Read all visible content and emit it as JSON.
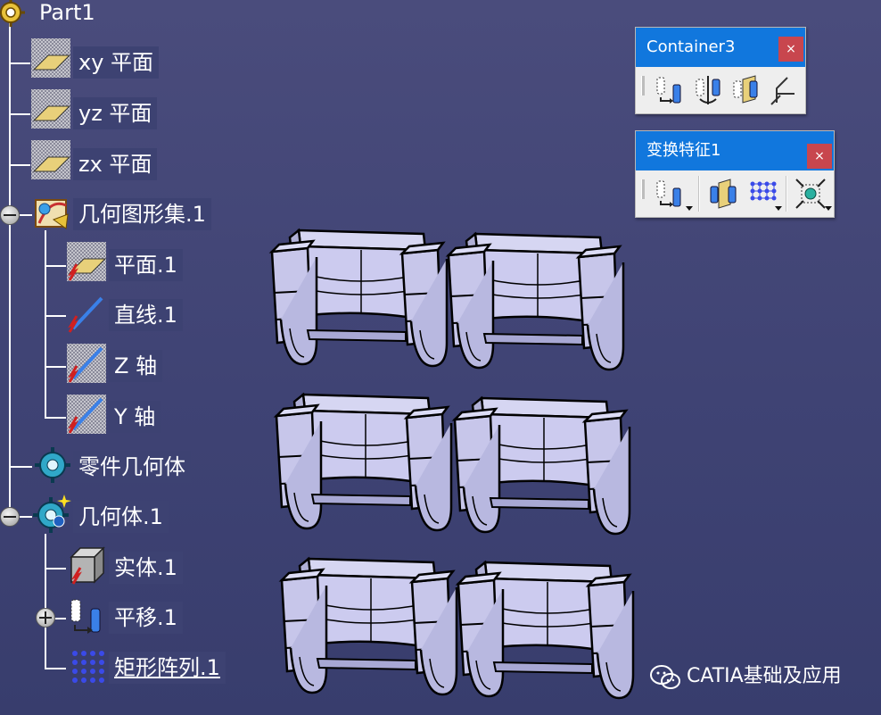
{
  "tree": {
    "root": {
      "label": "Part1",
      "icon": "part-gear-icon"
    },
    "nodes": [
      {
        "label": "xy 平面",
        "icon": "plane-icon"
      },
      {
        "label": "yz 平面",
        "icon": "plane-icon"
      },
      {
        "label": "zx 平面",
        "icon": "plane-icon"
      },
      {
        "label": "几何图形集.1",
        "icon": "geometrical-set-icon"
      },
      {
        "label": "平面.1",
        "icon": "plane-feature-icon"
      },
      {
        "label": "直线.1",
        "icon": "line-icon"
      },
      {
        "label": "Z 轴",
        "icon": "axis-icon"
      },
      {
        "label": "Y 轴",
        "icon": "axis-icon"
      },
      {
        "label": "零件几何体",
        "icon": "part-body-icon"
      },
      {
        "label": "几何体.1",
        "icon": "body-icon"
      },
      {
        "label": "实体.1",
        "icon": "solid-icon"
      },
      {
        "label": "平移.1",
        "icon": "translate-icon"
      },
      {
        "label": "矩形阵列.1",
        "icon": "rect-pattern-icon"
      }
    ]
  },
  "toolbars": {
    "container3": {
      "title": "Container3",
      "close": "×",
      "tools": [
        "translate-icon",
        "rotate-icon",
        "symmetry-icon",
        "axis-to-axis-icon"
      ]
    },
    "transform": {
      "title": "变换特征1",
      "close": "×",
      "tools": [
        "translate-dropdown-icon",
        "mirror-icon",
        "rect-pattern-dropdown-icon",
        "scale-dropdown-icon"
      ]
    }
  },
  "watermark": {
    "text": "CATIA基础及应用",
    "icon": "wechat-icon"
  },
  "colors": {
    "background": "#41457a",
    "toolbar_title": "#1177dd",
    "close": "#c8464e",
    "model_fill": "#cfd0f0"
  }
}
